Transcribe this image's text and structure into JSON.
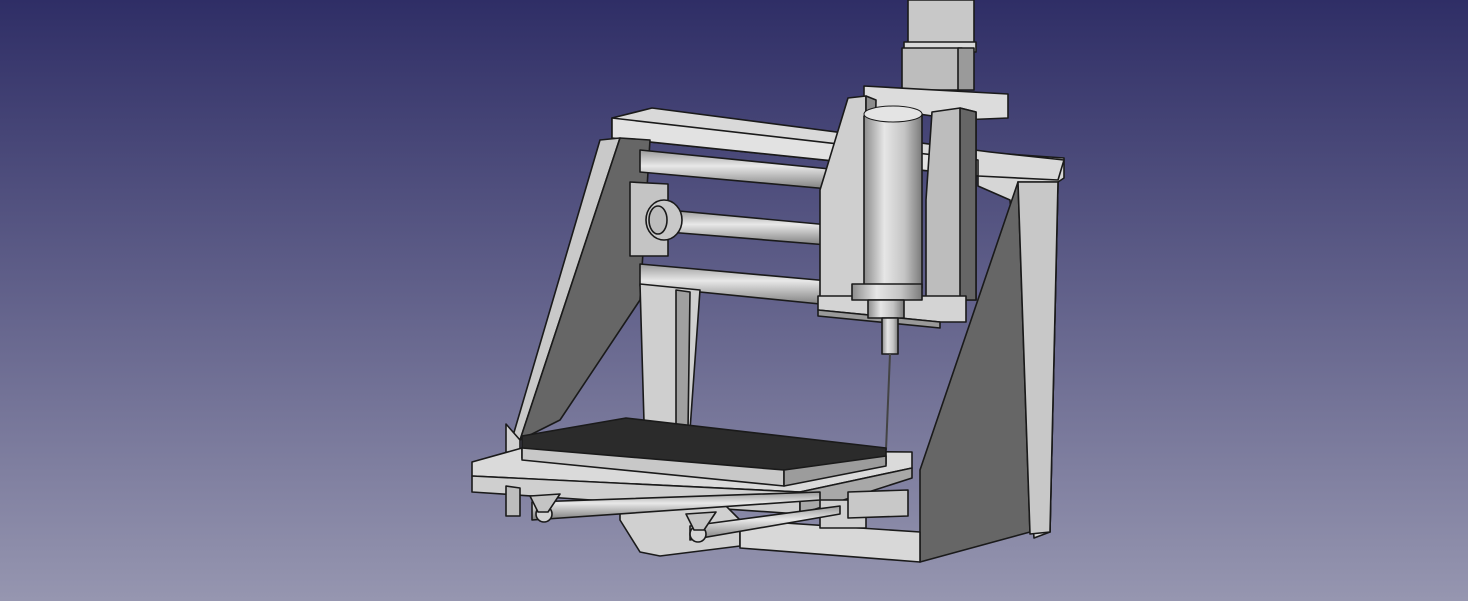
{
  "viewport": {
    "background_top": "#2f2e66",
    "background_bottom": "#9696b0"
  },
  "model": {
    "colors": {
      "light": "#d9d9d9",
      "mid": "#bdbdbd",
      "side": "#8a8a8a",
      "dark": "#666666",
      "black": "#2b2b2b",
      "edge": "#1a1a1a"
    }
  }
}
